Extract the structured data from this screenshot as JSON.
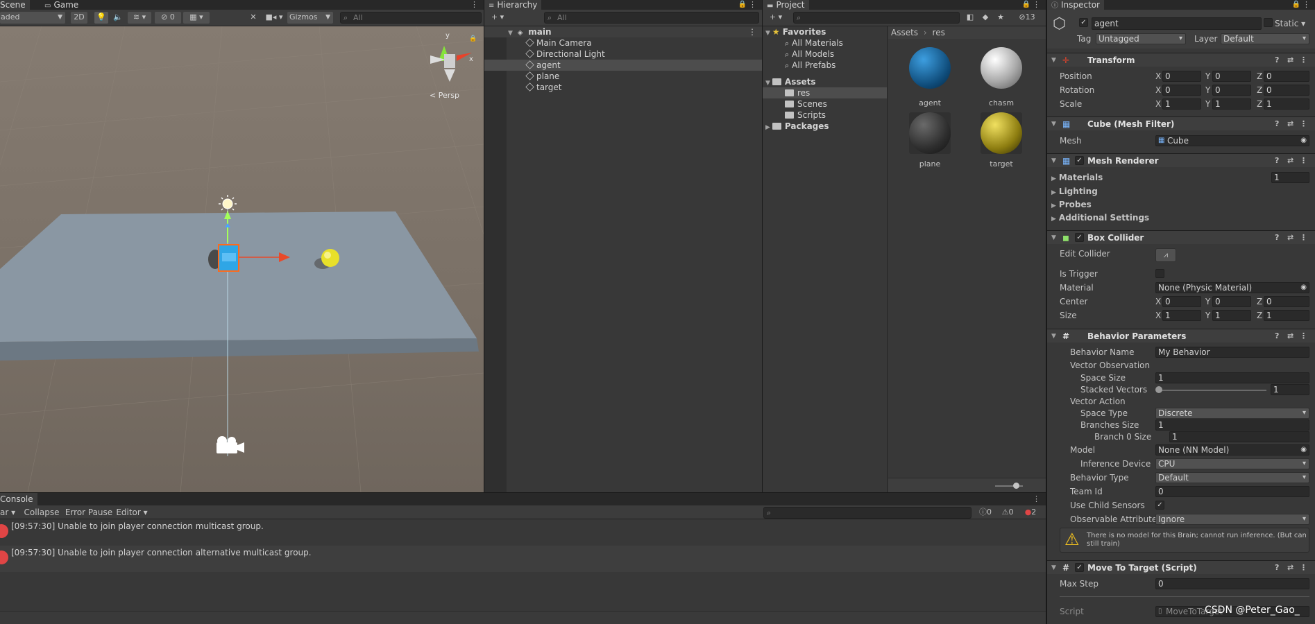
{
  "scene": {
    "tabs": [
      "Scene",
      "Game"
    ],
    "shading_mode": "aded",
    "btn_2d": "2D",
    "hidden_count": "0",
    "gizmos_label": "Gizmos",
    "search_placeholder": "All",
    "persp_label": "< Persp",
    "gizmo_y": "y",
    "gizmo_x": "x"
  },
  "hierarchy": {
    "tab": "Hierarchy",
    "search_placeholder": "All",
    "scene_name": "main",
    "items": [
      "Main Camera",
      "Directional Light",
      "agent",
      "plane",
      "target"
    ],
    "selected": "agent"
  },
  "project": {
    "tab": "Project",
    "hidden_count": "13",
    "favorites_label": "Favorites",
    "favorites": [
      "All Materials",
      "All Models",
      "All Prefabs"
    ],
    "assets_label": "Assets",
    "asset_folders": [
      "res",
      "Scenes",
      "Scripts"
    ],
    "packages_label": "Packages",
    "breadcrumb": [
      "Assets",
      "res"
    ],
    "thumbnails": [
      "agent",
      "chasm",
      "plane",
      "target"
    ]
  },
  "inspector": {
    "tab": "Inspector",
    "object_name": "agent",
    "static_label": "Static",
    "tag_label": "Tag",
    "tag_value": "Untagged",
    "layer_label": "Layer",
    "layer_value": "Default",
    "transform": {
      "title": "Transform",
      "position_label": "Position",
      "position": [
        "0",
        "0",
        "0"
      ],
      "rotation_label": "Rotation",
      "rotation": [
        "0",
        "0",
        "0"
      ],
      "scale_label": "Scale",
      "scale": [
        "1",
        "1",
        "1"
      ]
    },
    "axes": [
      "X",
      "Y",
      "Z"
    ],
    "mesh_filter": {
      "title": "Cube (Mesh Filter)",
      "mesh_label": "Mesh",
      "mesh_value": "Cube"
    },
    "mesh_renderer": {
      "title": "Mesh Renderer",
      "materials_label": "Materials",
      "materials_count": "1",
      "lighting": "Lighting",
      "probes": "Probes",
      "additional": "Additional Settings"
    },
    "box_collider": {
      "title": "Box Collider",
      "edit_label": "Edit Collider",
      "trigger_label": "Is Trigger",
      "material_label": "Material",
      "material_value": "None (Physic Material)",
      "center_label": "Center",
      "center": [
        "0",
        "0",
        "0"
      ],
      "size_label": "Size",
      "size": [
        "1",
        "1",
        "1"
      ]
    },
    "behavior": {
      "title": "Behavior Parameters",
      "name_label": "Behavior Name",
      "name_value": "My Behavior",
      "vector_obs": "Vector Observation",
      "space_size_label": "Space Size",
      "space_size": "1",
      "stacked_label": "Stacked Vectors",
      "stacked": "1",
      "stacked_level": 0.0,
      "vector_action": "Vector Action",
      "space_type_label": "Space Type",
      "space_type": "Discrete",
      "branches_label": "Branches Size",
      "branches": "1",
      "branch0_label": "Branch 0 Size",
      "branch0": "1",
      "model_label": "Model",
      "model_value": "None (NN Model)",
      "device_label": "Inference Device",
      "device_value": "CPU",
      "type_label": "Behavior Type",
      "type_value": "Default",
      "team_label": "Team Id",
      "team_value": "0",
      "child_label": "Use Child Sensors",
      "observable_label": "Observable Attribute",
      "observable_value": "Ignore",
      "warning": "There is no model for this Brain; cannot run inference. (But can still train)"
    },
    "move_to_target": {
      "title": "Move To Target (Script)",
      "max_step_label": "Max Step",
      "max_step": "0",
      "script_label": "Script",
      "script_value": "MoveToTarget"
    }
  },
  "console": {
    "tab": "Console",
    "clear_label": "ar",
    "collapse_label": "Collapse",
    "error_pause_label": "Error Pause",
    "editor_label": "Editor",
    "log_count": "0",
    "warn_count": "0",
    "error_count": "2",
    "messages": [
      "[09:57:30] Unable to join player connection multicast group.",
      "[09:57:30] Unable to join player connection alternative multicast group."
    ]
  },
  "watermark": "CSDN @Peter_Gao_",
  "colors": {
    "selection": "#2c5d87",
    "error": "#e04545",
    "scene_bg": "#7a7066",
    "plane": "#8a97a3"
  }
}
